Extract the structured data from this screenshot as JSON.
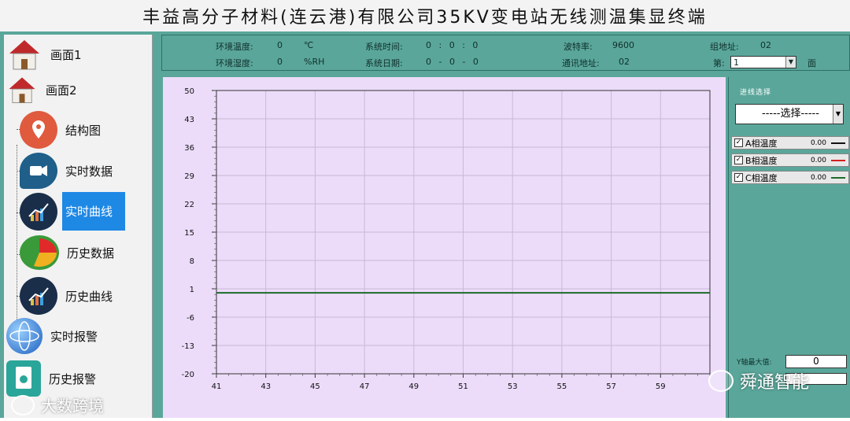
{
  "title": "丰益高分子材料(连云港)有限公司35KV变电站无线测温集显终端",
  "nav": [
    {
      "label": "画面1"
    },
    {
      "label": "画面2"
    },
    {
      "label": "结构图"
    },
    {
      "label": "实时数据"
    },
    {
      "label": "实时曲线"
    },
    {
      "label": "历史数据"
    },
    {
      "label": "历史曲线"
    },
    {
      "label": "实时报警"
    },
    {
      "label": "历史报警"
    }
  ],
  "info": {
    "env_temp_label": "环境温度:",
    "env_temp_value": "0",
    "env_temp_unit": "℃",
    "env_hum_label": "环境湿度:",
    "env_hum_value": "0",
    "env_hum_unit": "%RH",
    "sys_time_label": "系统时间:",
    "sys_time_value": "0 : 0 : 0",
    "sys_date_label": "系统日期:",
    "sys_date_value": "0 - 0 - 0",
    "baud_label": "波特率:",
    "baud_value": "9600",
    "comm_addr_label": "通讯地址:",
    "comm_addr_value": "02",
    "group_addr_label": "组地址:",
    "group_addr_value": "02",
    "page_label": "第:",
    "page_value": "1",
    "page_suffix": "面"
  },
  "right": {
    "line_select_label": "进线选择",
    "select_value": "-----选择-----",
    "legend": [
      {
        "label": "A相温度",
        "value": "0.00",
        "color": "#111111"
      },
      {
        "label": "B相温度",
        "value": "0.00",
        "color": "#d62020"
      },
      {
        "label": "C相温度",
        "value": "0.00",
        "color": "#1d6b2a"
      }
    ],
    "ymax_label": "Y轴最大值:",
    "ymax_value": "0"
  },
  "chart_data": {
    "type": "line",
    "xlim": [
      41,
      61
    ],
    "ylim": [
      -20,
      50
    ],
    "xticks": [
      "41",
      "43",
      "45",
      "47",
      "49",
      "51",
      "53",
      "55",
      "57",
      "59"
    ],
    "yticks": [
      "50",
      "43",
      "36",
      "29",
      "22",
      "15",
      "8",
      "1",
      "-6",
      "-13",
      "-20"
    ],
    "grid": true,
    "series": [
      {
        "x": [
          41,
          61
        ],
        "y": [
          0,
          0
        ],
        "color": "#1d6b2a"
      }
    ]
  },
  "watermark": {
    "left": "大数跨境",
    "right": "舜通智能"
  }
}
